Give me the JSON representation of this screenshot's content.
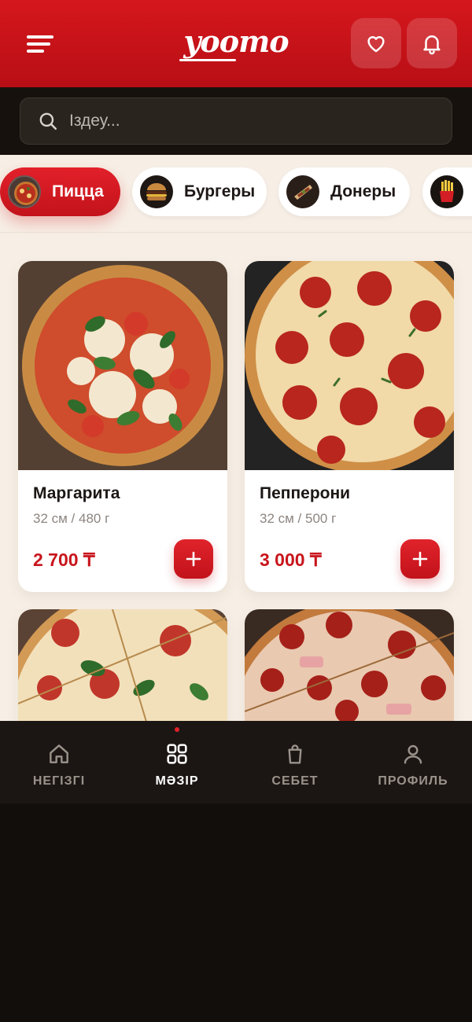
{
  "header": {
    "brand": "yoomo",
    "menu_icon": "menu-icon",
    "favorites_icon": "heart-icon",
    "notifications_icon": "bell-icon"
  },
  "search": {
    "placeholder": "Іздеу...",
    "icon": "search-icon"
  },
  "categories": [
    {
      "label": "Пицца",
      "active": true,
      "thumb": "pizza"
    },
    {
      "label": "Бургеры",
      "active": false,
      "thumb": "burger"
    },
    {
      "label": "Донеры",
      "active": false,
      "thumb": "doner"
    },
    {
      "label": "",
      "active": false,
      "thumb": "fries"
    }
  ],
  "products": [
    {
      "name": "Маргарита",
      "weight": "32 см / 480 г",
      "price": "2 700 ₸",
      "add_label": "+",
      "kind": "margherita"
    },
    {
      "name": "Пепперони",
      "weight": "32 см / 500 г",
      "price": "3 000 ₸",
      "add_label": "+",
      "kind": "pepperoni"
    }
  ],
  "bottom_nav": [
    {
      "label": "НЕГІЗГІ",
      "icon": "home-icon",
      "active": false
    },
    {
      "label": "МӘЗІР",
      "icon": "grid-icon",
      "active": true
    },
    {
      "label": "СЕБЕТ",
      "icon": "bag-icon",
      "active": false
    },
    {
      "label": "ПРОФИЛЬ",
      "icon": "user-icon",
      "active": false
    }
  ],
  "colors": {
    "brand_red": "#c8151c",
    "header_red": "#d5171c",
    "background_cream": "#f7efe6",
    "dark": "#120e0b"
  }
}
